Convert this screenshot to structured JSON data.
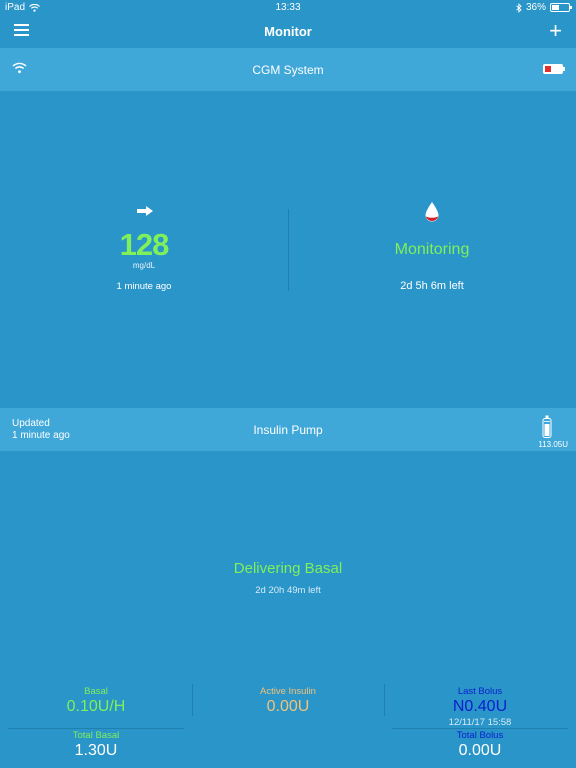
{
  "status_bar": {
    "device": "iPad",
    "time": "13:33",
    "battery_percent": "36%"
  },
  "nav": {
    "title": "Monitor",
    "add_label": "+"
  },
  "cgm": {
    "header_title": "CGM System",
    "glucose_value": "128",
    "glucose_units": "mg/dL",
    "last_reading": "1 minute ago",
    "sensor_status": "Monitoring",
    "sensor_time_left": "2d 5h 6m left"
  },
  "pump": {
    "updated_label": "Updated",
    "updated_ago": "1 minute ago",
    "header_title": "Insulin Pump",
    "reservoir_value": "113.05U",
    "delivery_status": "Delivering Basal",
    "delivery_time_left": "2d 20h 49m left"
  },
  "stats": {
    "basal_label": "Basal",
    "basal_value": "0.10U/H",
    "active_insulin_label": "Active Insulin",
    "active_insulin_value": "0.00U",
    "last_bolus_label": "Last Bolus",
    "last_bolus_value": "N0.40U",
    "last_bolus_date": "12/11/17 15:58",
    "total_basal_label": "Total Basal",
    "total_basal_value": "1.30U",
    "total_bolus_label": "Total Bolus",
    "total_bolus_value": "0.00U"
  },
  "colors": {
    "background": "#2a95c8",
    "header_band": "#40a8d8",
    "accent_green": "#7ff05a",
    "active_insulin_orange": "#f2c27a",
    "last_bolus_blue": "#0a1fcf",
    "battery_low_red": "#e0302f"
  },
  "icons": {
    "menu": "hamburger-icon",
    "add": "plus-icon",
    "signal": "wifi-icon",
    "cgm_battery": "battery-low-icon",
    "trend": "arrow-right-icon",
    "sensor": "blood-drop-icon",
    "reservoir": "insulin-reservoir-icon"
  }
}
